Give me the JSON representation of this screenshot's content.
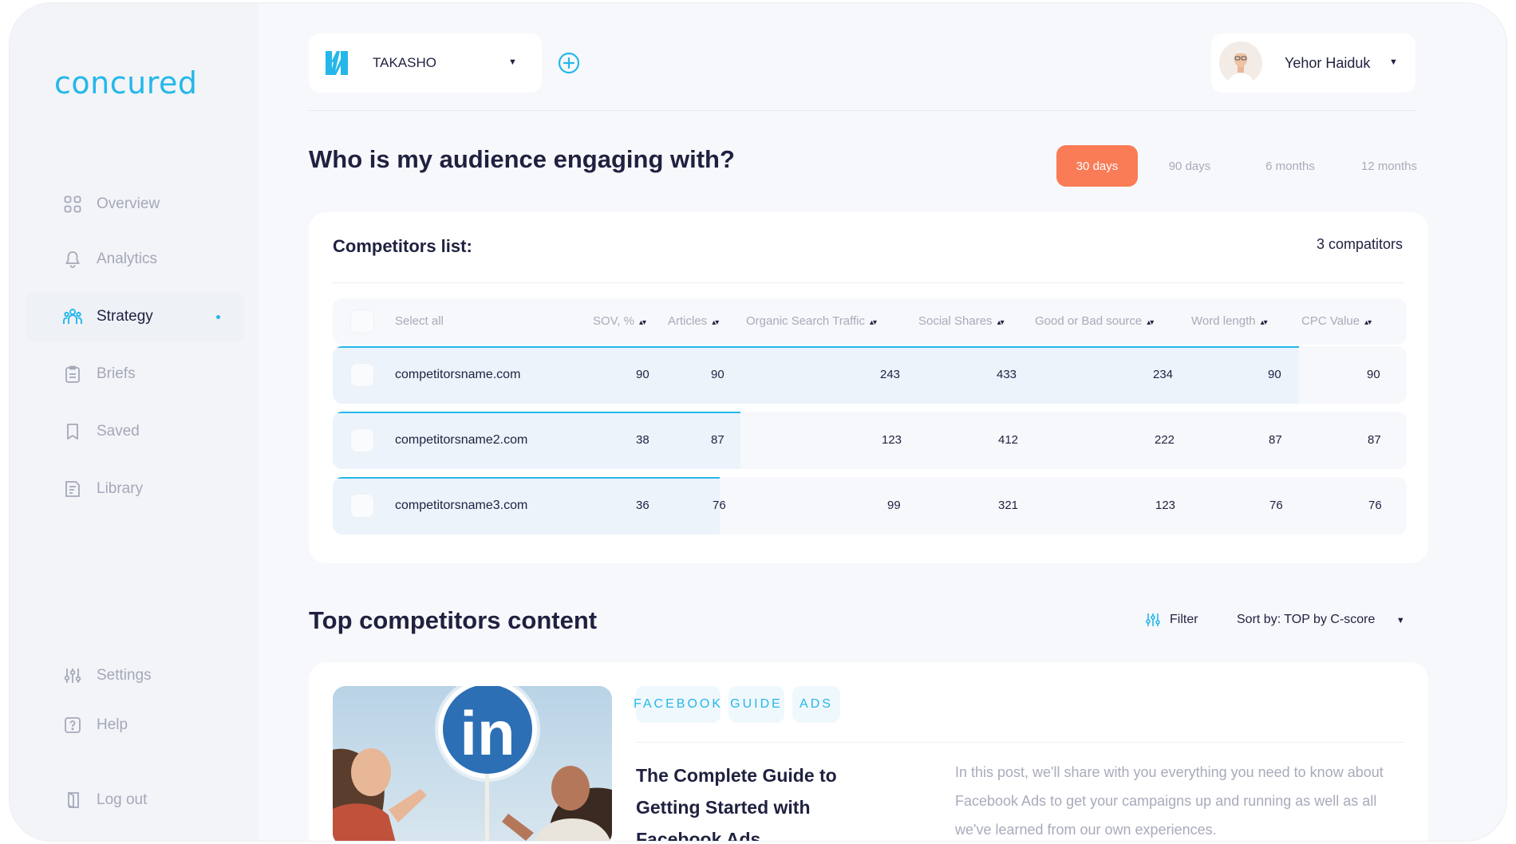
{
  "app": {
    "logo": "concured"
  },
  "sidebar": {
    "items": [
      {
        "label": "Overview"
      },
      {
        "label": "Analytics"
      },
      {
        "label": "Strategy"
      },
      {
        "label": "Briefs"
      },
      {
        "label": "Saved"
      },
      {
        "label": "Library"
      },
      {
        "label": "Settings"
      },
      {
        "label": "Help"
      },
      {
        "label": "Log out"
      }
    ],
    "active_color": "#25b7ea"
  },
  "topbar": {
    "workspace": "TAKASHO",
    "user_name": "Yehor Haiduk"
  },
  "page": {
    "title": "Who is my audience engaging with?",
    "periods": [
      "30 days",
      "90 days",
      "6 months",
      "12 months"
    ],
    "active_period": "30 days",
    "accent": "#fa7c57"
  },
  "competitors": {
    "title": "Competitors list:",
    "count": "3 compatitors",
    "columns": {
      "select": "Select all",
      "sov": "SOV, %",
      "articles": "Articles",
      "organic": "Organic Search Traffic",
      "social": "Social Shares",
      "source": "Good or Bad source",
      "word": "Word length",
      "cpc": "CPC Value"
    },
    "rows": [
      {
        "name": "competitorsname.com",
        "sov": "90",
        "articles": "90",
        "organic": "243",
        "social": "433",
        "source": "234",
        "word": "90",
        "cpc": "90",
        "sov_fraction": 0.9
      },
      {
        "name": "competitorsname2.com",
        "sov": "38",
        "articles": "87",
        "organic": "123",
        "social": "412",
        "source": "222",
        "word": "87",
        "cpc": "87",
        "sov_fraction": 0.38
      },
      {
        "name": "competitorsname3.com",
        "sov": "36",
        "articles": "76",
        "organic": "99",
        "social": "321",
        "source": "123",
        "word": "76",
        "cpc": "76",
        "sov_fraction": 0.36
      }
    ]
  },
  "top_content": {
    "title": "Top competitors content",
    "filter_label": "Filter",
    "sort_label": "Sort by: TOP by C-score",
    "article": {
      "tags": [
        "FACEBOOK",
        "GUIDE",
        "ADS"
      ],
      "title": "The Complete Guide to Getting Started with Facebook Ads",
      "description": "In this post, we'll share with you everything you need to know about Facebook Ads to get your campaigns up and running as well as all we've learned from our own experiences.",
      "thumbnail_badge": "in"
    }
  }
}
